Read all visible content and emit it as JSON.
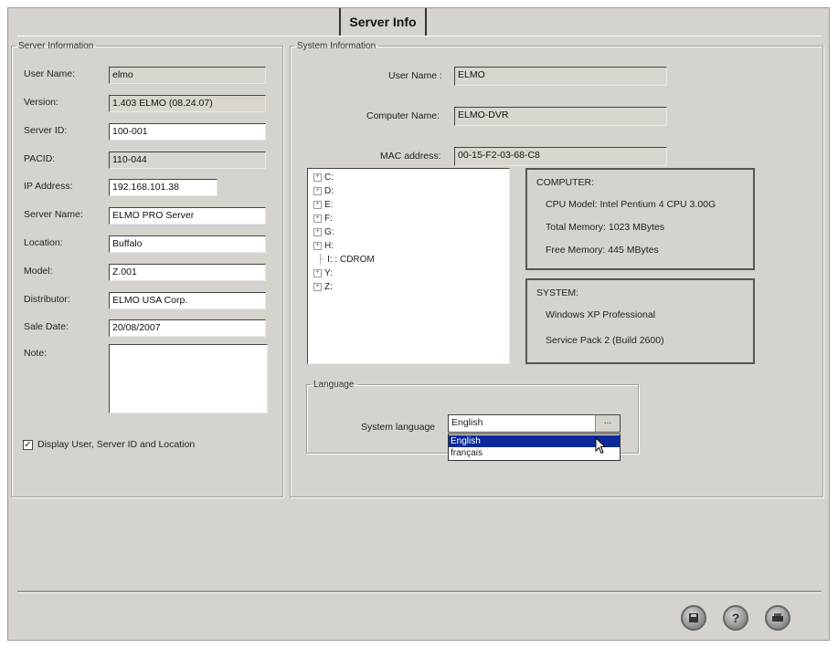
{
  "tab": {
    "label": "Server Info"
  },
  "server_info": {
    "legend": "Server Information",
    "fields": {
      "user_name": {
        "label": "User Name:",
        "value": "elmo"
      },
      "version": {
        "label": "Version:",
        "value": "1.403 ELMO (08.24.07)"
      },
      "server_id": {
        "label": "Server ID:",
        "value": "100-001"
      },
      "pacid": {
        "label": "PACID:",
        "value": "110-044"
      },
      "ip_address": {
        "label": "IP Address:",
        "value": "192.168.101.38"
      },
      "server_name": {
        "label": "Server Name:",
        "value": "ELMO PRO Server"
      },
      "location": {
        "label": "Location:",
        "value": "Buffalo"
      },
      "model": {
        "label": "Model:",
        "value": "Z.001"
      },
      "distributor": {
        "label": "Distributor:",
        "value": "ELMO USA Corp."
      },
      "sale_date": {
        "label": "Sale Date:",
        "value": "20/08/2007"
      },
      "note": {
        "label": "Note:",
        "value": ""
      }
    },
    "display_checkbox": {
      "label": "Display User, Server ID and Location",
      "checked": true
    }
  },
  "system_info": {
    "legend": "System Information",
    "user_name": {
      "label": "User Name :",
      "value": "ELMO"
    },
    "computer_name": {
      "label": "Computer Name:",
      "value": "ELMO-DVR"
    },
    "mac_address": {
      "label": "MAC address:",
      "value": "00-15-F2-03-68-C8"
    },
    "drives": [
      {
        "label": "C:",
        "expander": "+"
      },
      {
        "label": "D:",
        "expander": "+"
      },
      {
        "label": "E:",
        "expander": "+"
      },
      {
        "label": "F:",
        "expander": "+"
      },
      {
        "label": "G:",
        "expander": "+"
      },
      {
        "label": "H:",
        "expander": "+"
      },
      {
        "label": "I: : CDROM",
        "expander": ""
      },
      {
        "label": "Y:",
        "expander": "+"
      },
      {
        "label": "Z:",
        "expander": "+"
      }
    ],
    "computer": {
      "title": "COMPUTER:",
      "cpu": "CPU Model: Intel Pentium 4 CPU 3.00G",
      "total_memory": "Total Memory: 1023 MBytes",
      "free_memory": "Free Memory: 445 MBytes"
    },
    "system": {
      "title": "SYSTEM:",
      "os": "Windows XP Professional",
      "service_pack": "Service Pack 2 (Build 2600)"
    },
    "language": {
      "legend": "Language",
      "label": "System language",
      "value": "English",
      "button": "...",
      "options": [
        "English",
        "français"
      ],
      "selected": "English"
    }
  },
  "footer_buttons": [
    {
      "name": "save",
      "icon": "save-icon"
    },
    {
      "name": "help",
      "icon": "help-icon"
    },
    {
      "name": "print",
      "icon": "printer-icon"
    }
  ],
  "colors": {
    "window_bg": "#d6d3ce",
    "readonly_bg": "#d9d6cf",
    "selection": "#0a2a9a"
  }
}
